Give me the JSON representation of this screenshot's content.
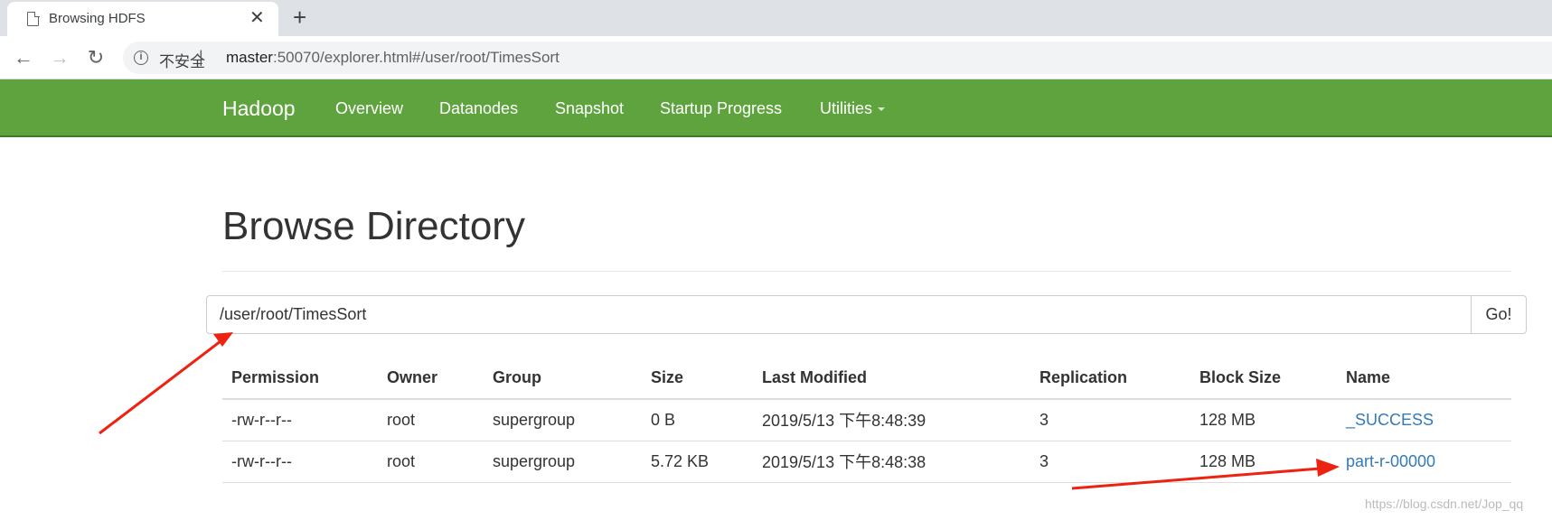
{
  "browser": {
    "tab_title": "Browsing HDFS",
    "security_label": "不安全",
    "separator": "|",
    "url_host": "master",
    "url_rest": ":50070/explorer.html#/user/root/TimesSort"
  },
  "navbar": {
    "brand": "Hadoop",
    "items": [
      {
        "label": "Overview"
      },
      {
        "label": "Datanodes"
      },
      {
        "label": "Snapshot"
      },
      {
        "label": "Startup Progress"
      },
      {
        "label": "Utilities"
      }
    ],
    "color": "#5fa33e"
  },
  "main": {
    "title": "Browse Directory",
    "path_value": "/user/root/TimesSort",
    "go_label": "Go!"
  },
  "table": {
    "headers": [
      "Permission",
      "Owner",
      "Group",
      "Size",
      "Last Modified",
      "Replication",
      "Block Size",
      "Name"
    ],
    "rows": [
      [
        "-rw-r--r--",
        "root",
        "supergroup",
        "0 B",
        "2019/5/13 下午8:48:39",
        "3",
        "128 MB",
        "_SUCCESS"
      ],
      [
        "-rw-r--r--",
        "root",
        "supergroup",
        "5.72 KB",
        "2019/5/13 下午8:48:38",
        "3",
        "128 MB",
        "part-r-00000"
      ]
    ],
    "link_color": "#337ab7"
  },
  "watermark": "https://blog.csdn.net/Jop_qq",
  "annotation_color": "#ee2211"
}
